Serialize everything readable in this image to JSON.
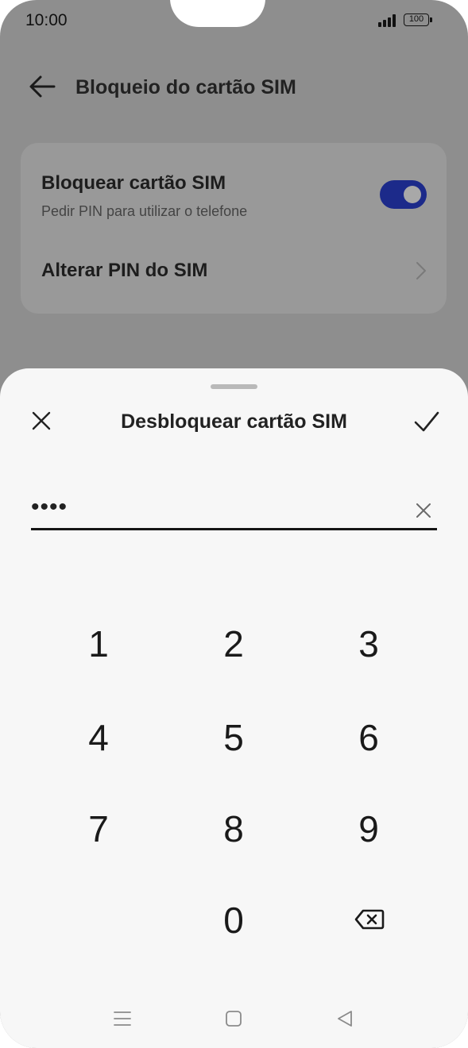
{
  "status_bar": {
    "time": "10:00",
    "battery": "100"
  },
  "header": {
    "title": "Bloqueio do cartão SIM"
  },
  "settings": {
    "lock_sim": {
      "title": "Bloquear cartão SIM",
      "subtitle": "Pedir PIN para utilizar o telefone",
      "enabled": true
    },
    "change_pin": {
      "title": "Alterar PIN do SIM"
    }
  },
  "dialog": {
    "title": "Desbloquear cartão SIM",
    "pin_value": "••••",
    "keypad": [
      "1",
      "2",
      "3",
      "4",
      "5",
      "6",
      "7",
      "8",
      "9",
      "0"
    ]
  },
  "colors": {
    "accent": "#1c2a8a",
    "scrim": "#8e8e8e",
    "sheet": "#f7f7f7"
  },
  "icons": [
    "back-arrow-icon",
    "chevron-right-icon",
    "close-icon",
    "check-icon",
    "clear-icon",
    "backspace-icon",
    "menu-icon",
    "home-icon",
    "back-icon"
  ]
}
